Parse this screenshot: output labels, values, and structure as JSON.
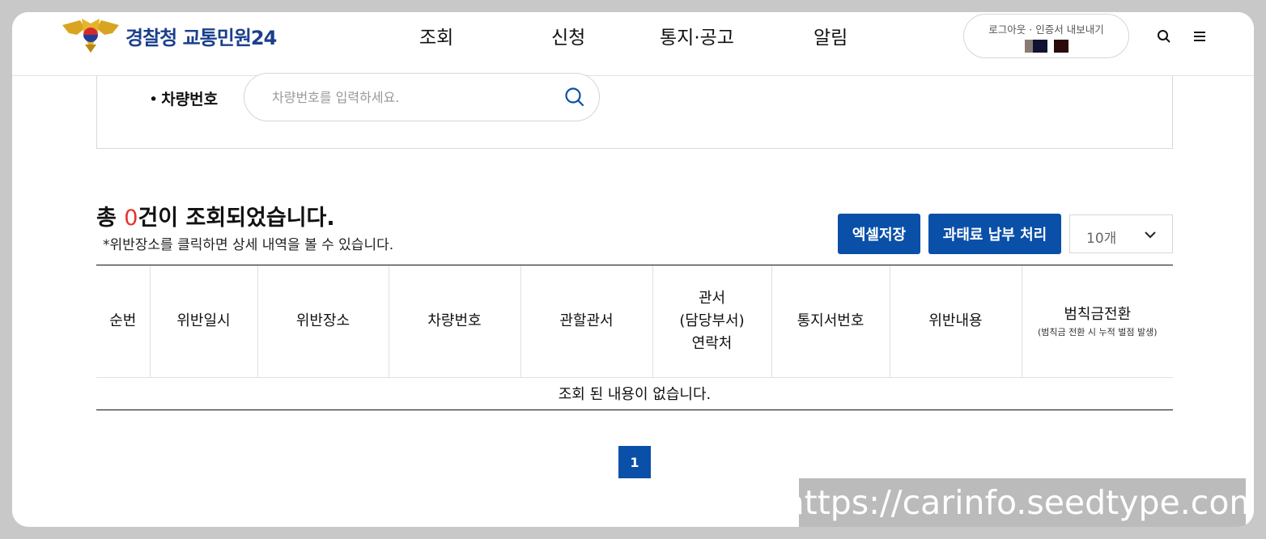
{
  "header": {
    "logo_text": "경찰청 교통민원24",
    "nav": [
      {
        "label": "조회"
      },
      {
        "label": "신청"
      },
      {
        "label": "통지·공고"
      },
      {
        "label": "알림"
      }
    ],
    "account_links": "로그아웃 · 인증서 내보내기",
    "swatch_colors": [
      "#8a7b72",
      "#121232",
      "#2a0a0a"
    ]
  },
  "search": {
    "label": "차량번호",
    "placeholder": "차량번호를 입력하세요."
  },
  "results": {
    "prefix": "총 ",
    "count": "0",
    "suffix": "건이 조회되었습니다.",
    "note": "*위반장소를 클릭하면 상세 내역을 볼 수 있습니다.",
    "excel_button": "엑셀저장",
    "pay_button": "과태료 납부 처리",
    "page_size": "10개"
  },
  "table": {
    "columns": [
      "순번",
      "위반일시",
      "위반장소",
      "차량번호",
      "관할관서",
      "관서\n(담당부서)\n연락처",
      "통지서번호",
      "위반내용",
      "범칙금전환"
    ],
    "last_col_sub": "(범칙금 전환 시 누적 벌점 발생)",
    "empty_text": "조회 된 내용이 없습니다."
  },
  "pagination": {
    "current": "1"
  },
  "watermark": "https://carinfo.seedtype.com",
  "colors": {
    "primary": "#0a4fa8",
    "accent_red": "#e8322f"
  }
}
